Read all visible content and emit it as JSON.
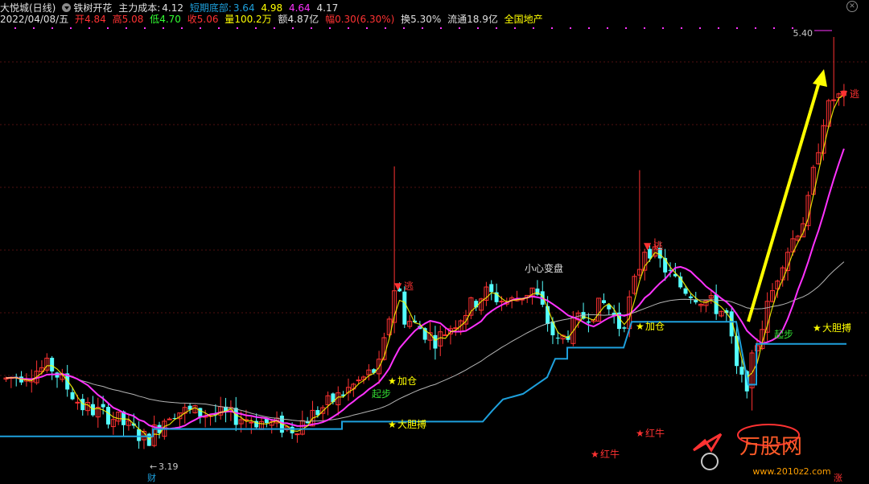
{
  "header": {
    "stock_name": "大悦城(日线)",
    "indicator_name": "铁树开花",
    "cost_label": "主力成本:",
    "cost_value": "4.12",
    "short_bottom_label": "短期底部:",
    "short_bottom_value": "3.64",
    "v2": "4.98",
    "v3": "4.64",
    "v4": "4.17",
    "date": "2022/04/08/五",
    "open_label": "开",
    "open_value": "4.84",
    "high_label": "高",
    "high_value": "5.08",
    "low_label": "低",
    "low_value": "4.70",
    "close_label": "收",
    "close_value": "5.06",
    "volume_label": "量",
    "volume_value": "100.2万",
    "amount_label": "额",
    "amount_value": "4.87亿",
    "change_label": "幅",
    "change_value": "0.30(6.30%)",
    "turnover_label": "换",
    "turnover_value": "5.30%",
    "float_label": "流通",
    "float_value": "18.9亿",
    "sector": "全国地产"
  },
  "annotations": {
    "top_price": "5.40",
    "low_price": "3.19",
    "cai": "财",
    "zhang": "涨",
    "escape": "逃",
    "add_position": "加仓",
    "start": "起步",
    "bold_bet": "大胆搏",
    "red_bull": "红牛",
    "caution": "小心变盘",
    "watermark": "万股网",
    "watermark_url": "www.2010z2.com"
  },
  "colors": {
    "up": "#ff3232",
    "down": "#54ffff",
    "ma_magenta": "#ff32ff",
    "ma_gray": "#b4b4b4",
    "support": "#1ea0dc",
    "yellow": "#ffff00",
    "grid": "#501010"
  }
}
